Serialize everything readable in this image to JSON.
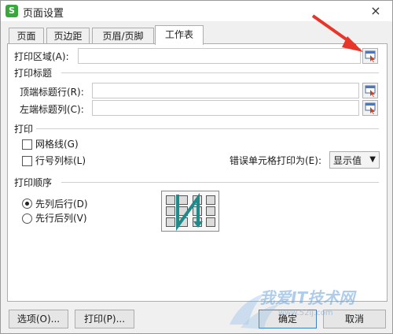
{
  "window": {
    "title": "页面设置",
    "close_glyph": "×",
    "app_icon_letter": "S"
  },
  "tabs": [
    {
      "label": "页面",
      "active": false
    },
    {
      "label": "页边距",
      "active": false
    },
    {
      "label": "页眉/页脚",
      "active": false
    },
    {
      "label": "工作表",
      "active": true
    }
  ],
  "print_area": {
    "label": "打印区域(A):",
    "value": ""
  },
  "print_titles": {
    "section": "打印标题",
    "top_rows_label": "顶端标题行(R):",
    "top_rows_value": "",
    "left_cols_label": "左端标题列(C):",
    "left_cols_value": ""
  },
  "print": {
    "section": "打印",
    "gridlines_label": "网格线(G)",
    "gridlines_checked": false,
    "rowcol_headers_label": "行号列标(L)",
    "rowcol_headers_checked": false,
    "errors_label": "错误单元格打印为(E):",
    "errors_value": "显示值"
  },
  "print_order": {
    "section": "打印顺序",
    "down_then_over_label": "先列后行(D)",
    "down_then_over_selected": true,
    "over_then_down_label": "先行后列(V)",
    "over_then_down_selected": false
  },
  "buttons": {
    "options": "选项(O)...",
    "print": "打印(P)...",
    "ok": "确定",
    "cancel": "取消"
  },
  "watermark": {
    "text": "我爱IT技术网",
    "url": "www.52ij.com"
  },
  "colors": {
    "accent": "#3c7fc4",
    "annotation_arrow": "#e8352a",
    "order_arrow": "#1f8a8a",
    "app_icon": "#39a83b"
  },
  "icons": {
    "range_picker": "range-picker-icon",
    "dropdown": "chevron-down-icon"
  }
}
